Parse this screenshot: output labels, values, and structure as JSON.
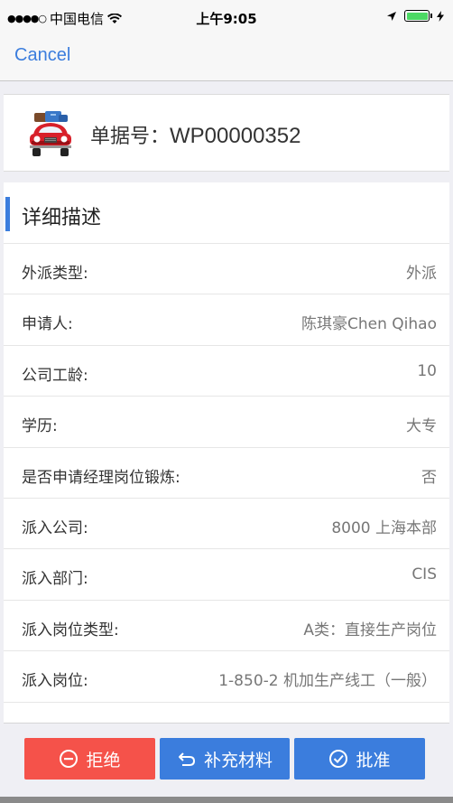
{
  "status_bar": {
    "signal": "●●●●○",
    "carrier": "中国电信",
    "time": "上午9:05",
    "battery_percent": 100
  },
  "nav": {
    "cancel_label": "Cancel"
  },
  "document": {
    "number_label": "单据号：",
    "number_value": "WP00000352"
  },
  "section": {
    "title": "详细描述"
  },
  "rows": [
    {
      "label": "外派类型:",
      "value": "外派"
    },
    {
      "label": "申请人:",
      "value": "陈琪豪Chen Qihao"
    },
    {
      "label": "公司工龄:",
      "value": "10"
    },
    {
      "label": "学历:",
      "value": "大专"
    },
    {
      "label": "是否申请经理岗位锻炼:",
      "value": "否"
    },
    {
      "label": "派入公司:",
      "value": "8000 上海本部"
    },
    {
      "label": "派入部门:",
      "value": "CIS"
    },
    {
      "label": "派入岗位类型:",
      "value": "A类：直接生产岗位"
    },
    {
      "label": "派入岗位:",
      "value": "1-850-2 机加生产线工（一般）"
    }
  ],
  "actions": {
    "reject_label": "拒绝",
    "supplement_label": "补充材料",
    "approve_label": "批准"
  },
  "colors": {
    "accent": "#3b7ddd",
    "reject": "#f5524a",
    "battery": "#4cd964"
  }
}
